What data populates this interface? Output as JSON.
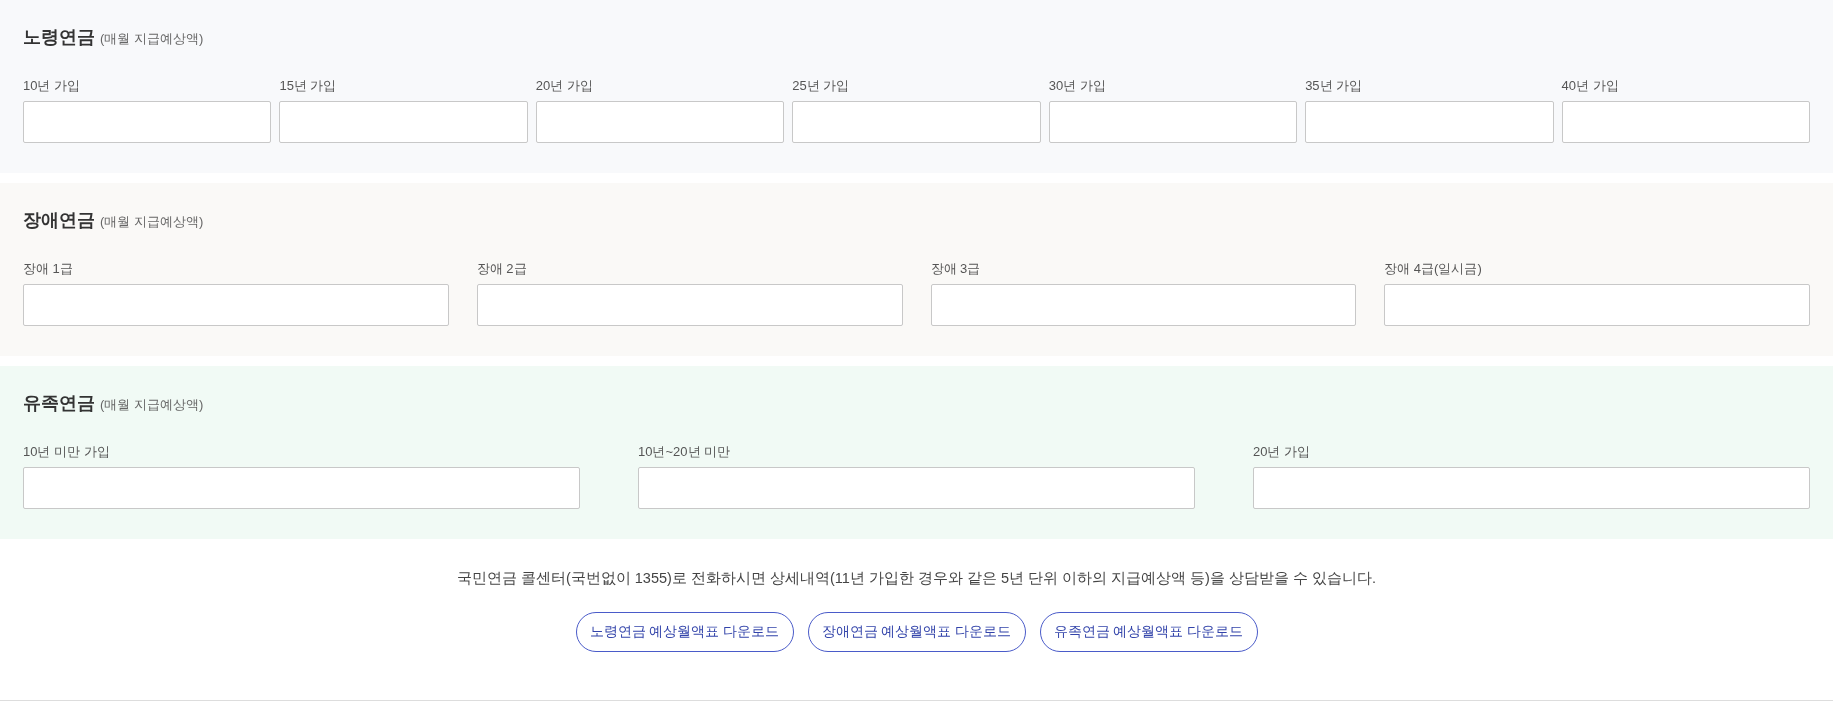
{
  "sections": [
    {
      "title": "노령연금",
      "note": "(매월 지급예상액)",
      "color": "#f8f9fb",
      "fields": [
        {
          "label": "10년 가입"
        },
        {
          "label": "15년 가입"
        },
        {
          "label": "20년 가입"
        },
        {
          "label": "25년 가입"
        },
        {
          "label": "30년 가입"
        },
        {
          "label": "35년 가입"
        },
        {
          "label": "40년 가입"
        }
      ]
    },
    {
      "title": "장애연금",
      "note": "(매월 지급예상액)",
      "color": "#faf9f7",
      "fields": [
        {
          "label": "장애 1급"
        },
        {
          "label": "장애 2급"
        },
        {
          "label": "장애 3급"
        },
        {
          "label": "장애 4급(일시금)"
        }
      ]
    },
    {
      "title": "유족연금",
      "note": "(매월 지급예상액)",
      "color": "#f1faf5",
      "fields": [
        {
          "label": "10년 미만 가입"
        },
        {
          "label": "10년~20년 미만"
        },
        {
          "label": "20년 가입"
        }
      ]
    }
  ],
  "notice": "국민연금 콜센터(국번없이 1355)로 전화하시면 상세내역(11년 가입한 경우와 같은 5년 단위 이하의 지급예상액 등)을 상담받을 수 있습니다.",
  "buttons": [
    "노령연금 예상월액표 다운로드",
    "장애연금 예상월액표 다운로드",
    "유족연금 예상월액표 다운로드"
  ]
}
